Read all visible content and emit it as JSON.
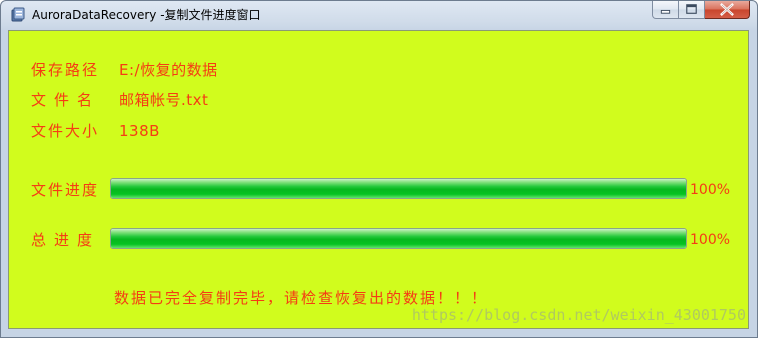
{
  "window": {
    "title": "AuroraDataRecovery -复制文件进度窗口",
    "icon": "app-icon"
  },
  "fields": {
    "save_path_label": "保存路径",
    "save_path_value": "E:/恢复的数据",
    "file_name_label": "文件名",
    "file_name_value": "邮箱帐号.txt",
    "file_size_label": "文件大小",
    "file_size_value": "138B"
  },
  "progress": {
    "file_label": "文件进度",
    "file_percent_text": "100%",
    "file_value": 1.0,
    "total_label": "总进度",
    "total_percent_text": "100%",
    "total_value": 1.0
  },
  "message": "数据已完全复制完毕，请检查恢复出的数据！！！",
  "watermark": "https://blog.csdn.net/weixin_43001750",
  "colors": {
    "background": "#d1fc1d",
    "text": "#f53c14",
    "progress_fill": "#06b81e"
  }
}
